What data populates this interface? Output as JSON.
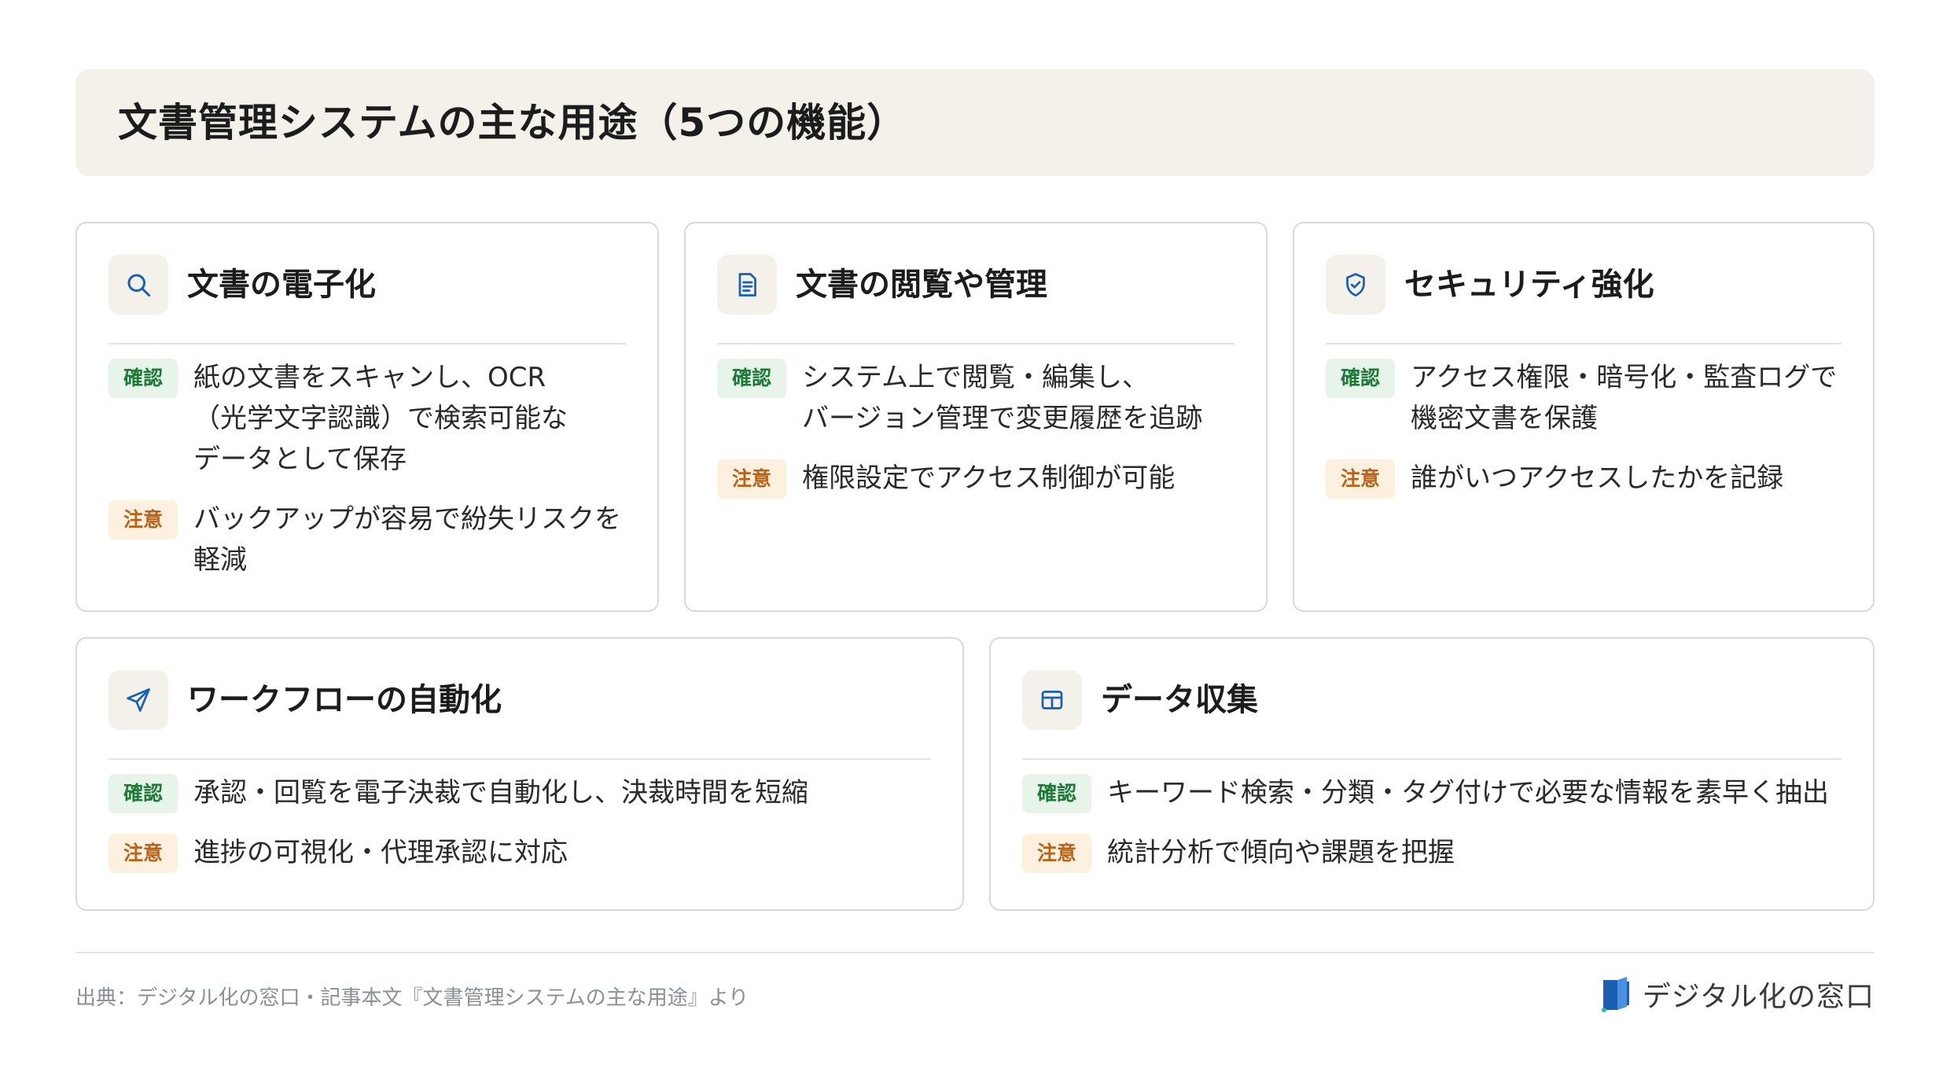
{
  "header": {
    "title": "文書管理システムの主な用途（5つの機能）"
  },
  "tags": {
    "confirm": "確認",
    "caution": "注意"
  },
  "colors": {
    "accent": "#1a5fb4",
    "confirm": "#1f7a3a",
    "caution": "#b8621a",
    "header_bg": "#f4f1ea"
  },
  "cards": [
    {
      "icon": "search-icon",
      "title": "文書の電子化",
      "confirm": "紙の文書をスキャンし、OCR\n（光学文字認識）で検索可能な\nデータとして保存",
      "caution": "バックアップが容易で紛失リスクを\n軽減"
    },
    {
      "icon": "document-icon",
      "title": "文書の閲覧や管理",
      "confirm": "システム上で閲覧・編集し、\nバージョン管理で変更履歴を追跡",
      "caution": "権限設定でアクセス制御が可能"
    },
    {
      "icon": "shield-check-icon",
      "title": "セキュリティ強化",
      "confirm": "アクセス権限・暗号化・監査ログで\n機密文書を保護",
      "caution": "誰がいつアクセスしたかを記録"
    },
    {
      "icon": "send-icon",
      "title": "ワークフローの自動化",
      "confirm": "承認・回覧を電子決裁で自動化し、決裁時間を短縮",
      "caution": "進捗の可視化・代理承認に対応"
    },
    {
      "icon": "table-icon",
      "title": "データ収集",
      "confirm": "キーワード検索・分類・タグ付けで必要な情報を素早く抽出",
      "caution": "統計分析で傾向や課題を把握"
    }
  ],
  "footer": {
    "source": "出典：デジタル化の窓口・記事本文『文書管理システムの主な用途』より",
    "brand": "デジタル化の窓口"
  }
}
